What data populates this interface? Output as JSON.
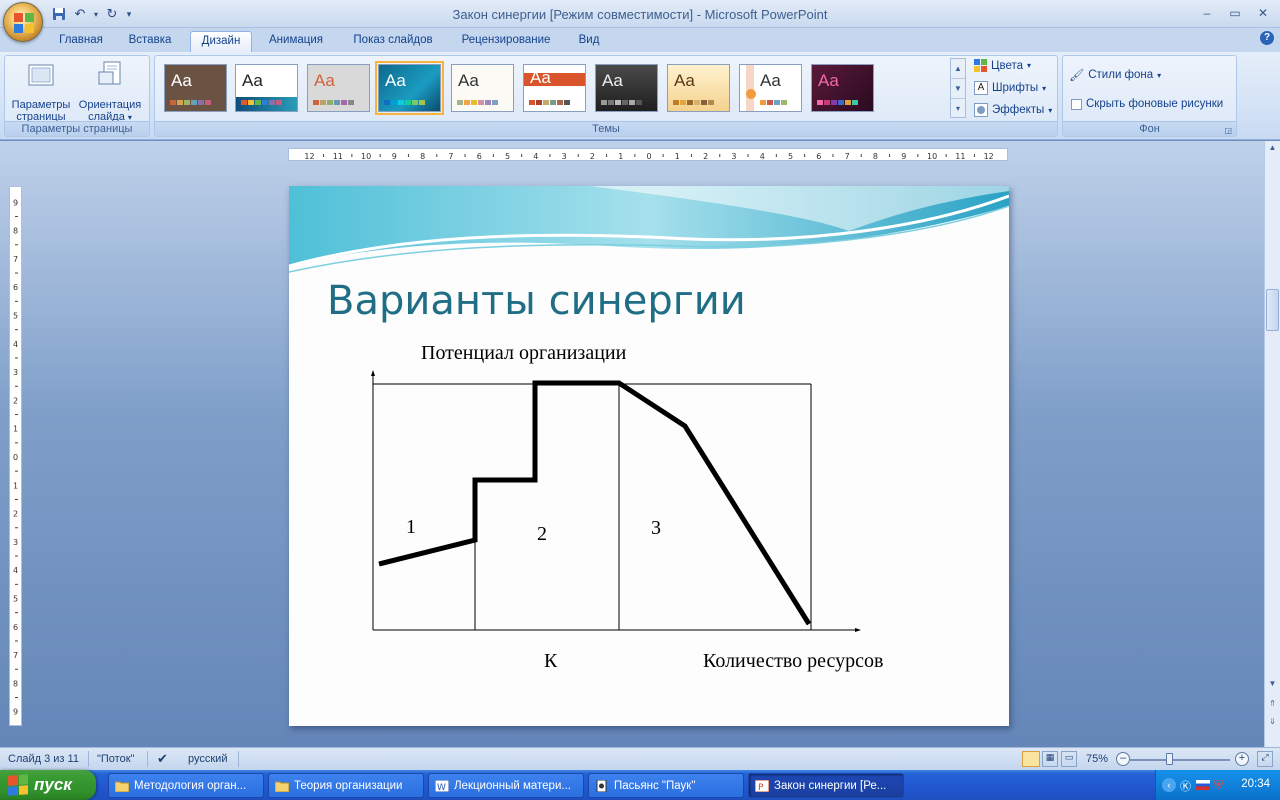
{
  "window": {
    "title": "Закон синергии [Режим совместимости] - Microsoft PowerPoint"
  },
  "ribbon_tabs": [
    {
      "label": "Главная",
      "active": false
    },
    {
      "label": "Вставка",
      "active": false
    },
    {
      "label": "Дизайн",
      "active": true
    },
    {
      "label": "Анимация",
      "active": false
    },
    {
      "label": "Показ слайдов",
      "active": false
    },
    {
      "label": "Рецензирование",
      "active": false
    },
    {
      "label": "Вид",
      "active": false
    }
  ],
  "ribbon": {
    "page_setup": {
      "btn_params": "Параметры страницы",
      "btn_orientation": "Ориентация слайда",
      "label": "Параметры страницы"
    },
    "themes": {
      "label": "Темы",
      "sample": "Aa"
    },
    "theme_options": {
      "colors": "Цвета",
      "fonts": "Шрифты",
      "effects": "Эффекты"
    },
    "background": {
      "styles": "Стили фона",
      "hide": "Скрыть фоновые рисунки",
      "label": "Фон"
    }
  },
  "slide": {
    "title": "Варианты синергии",
    "y_axis_label": "Потенциал организации",
    "x_axis_label": "Количество ресурсов",
    "k_label": "К",
    "zones": [
      "1",
      "2",
      "3"
    ]
  },
  "status": {
    "slide_info": "Слайд 3 из 11",
    "theme": "\"Поток\"",
    "language": "русский",
    "zoom": "75%"
  },
  "taskbar": {
    "start": "пуск",
    "tasks": [
      {
        "label": "Методология орган..."
      },
      {
        "label": "Теория организации"
      },
      {
        "label": "Лекционный матери..."
      },
      {
        "label": "Пасьянс \"Паук\""
      },
      {
        "label": "Закон синергии [Ре..."
      }
    ],
    "clock": "20:34"
  },
  "colors": {
    "title_text": "#1f6e86",
    "accent": "#2a9cb8",
    "taskbar": "#2156cf",
    "start": "#3a9c34"
  }
}
